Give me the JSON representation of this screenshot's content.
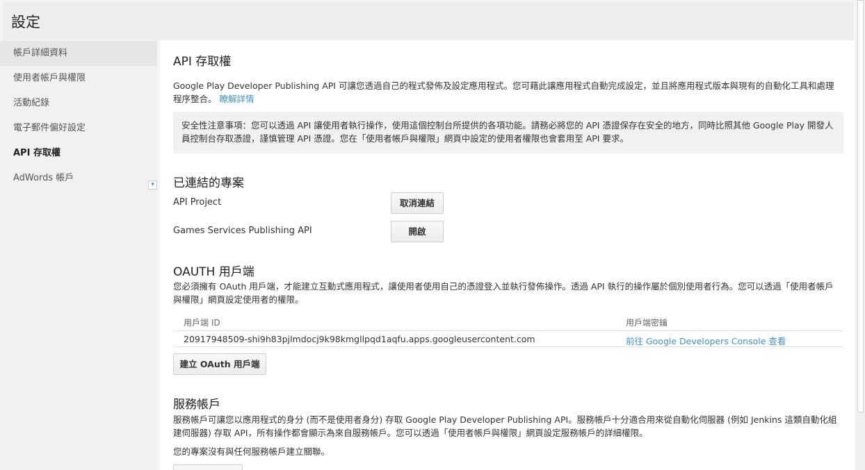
{
  "header": {
    "title": "設定"
  },
  "sidebar": {
    "items": [
      {
        "label": "帳戶詳細資料"
      },
      {
        "label": "使用者帳戶與權限"
      },
      {
        "label": "活動紀錄"
      },
      {
        "label": "電子郵件偏好設定"
      },
      {
        "label": "API 存取權"
      },
      {
        "label": "AdWords 帳戶"
      }
    ],
    "toggle_glyph": "▾"
  },
  "main": {
    "api_section": {
      "title": "API 存取權",
      "description": "Google Play Developer Publishing API 可讓您透過自己的程式發佈及設定應用程式。您可藉此讓應用程式自動完成設定，並且將應用程式版本與現有的自動化工具和處理程序整合。",
      "learn_more": "瞭解詳情",
      "notice": "安全性注意事項：您可以透過 API 讓使用者執行操作，使用這個控制台所提供的各項功能。請務必將您的 API 憑證保存在安全的地方，同時比照其他 Google Play 開發人員控制台存取憑證，謹慎管理 API 憑證。您在「使用者帳戶與權限」網頁中設定的使用者權限也會套用至 API 要求。"
    },
    "linked_projects": {
      "title": "已連結的專案",
      "rows": [
        {
          "name": "API Project",
          "button": "取消連結"
        },
        {
          "name": "Games Services Publishing API",
          "button": "開啟"
        }
      ]
    },
    "oauth": {
      "title": "OAUTH 用戶端",
      "description": "您必須擁有 OAuth 用戶端，才能建立互動式應用程式，讓使用者使用自己的憑證登入並執行發佈操作。透過 API 執行的操作屬於個別使用者行為。您可以透過「使用者帳戶與權限」網頁設定使用者的權限。",
      "columns": [
        "用戶端 ID",
        "用戶端密鑰"
      ],
      "rows": [
        {
          "client_id": "20917948509-shi9h83pjlmdocj9k98kmgllpqd1aqfu.apps.googleusercontent.com",
          "secret": "前往 Google Developers Console 查看"
        }
      ],
      "create_button": "建立 OAuth 用戶端"
    },
    "service_accounts": {
      "title": "服務帳戶",
      "description": "服務帳戶可讓您以應用程式的身分 (而不是使用者身分) 存取 Google Play Developer Publishing API。服務帳戶十分適合用來從自動化伺服器 (例如 Jenkins 這類自動化組建伺服器) 存取 API，所有操作都會顯示為來自服務帳戶。您可以透過「使用者帳戶與權限」網頁設定服務帳戶的詳細權限。",
      "empty_text": "您的專案沒有與任何服務帳戶建立關聯。"
    }
  },
  "colors": {
    "link": "#3b95c7",
    "sidebar_bg": "#f1f1f1",
    "header_bg": "#eeeeee"
  }
}
